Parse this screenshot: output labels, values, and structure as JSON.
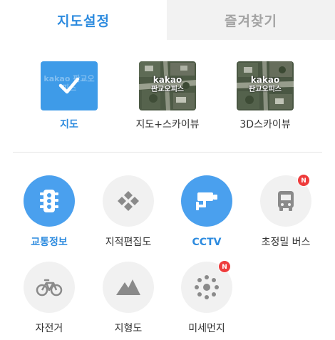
{
  "tabs": [
    {
      "label": "지도설정",
      "active": true
    },
    {
      "label": "즐겨찾기",
      "active": false
    }
  ],
  "map_types": [
    {
      "label": "지도",
      "selected": true,
      "thumb_text": "kakao 판교오피스",
      "icon": "check-icon"
    },
    {
      "label": "지도+스카이뷰",
      "selected": false,
      "thumb_line1": "kakao",
      "thumb_line2": "판교오피스"
    },
    {
      "label": "3D스카이뷰",
      "selected": false,
      "thumb_line1": "kakao",
      "thumb_line2": "판교오피스"
    }
  ],
  "layers": [
    {
      "label": "교통정보",
      "active": true,
      "icon": "traffic-light-icon"
    },
    {
      "label": "지적편집도",
      "active": false,
      "icon": "cadastral-diamonds-icon"
    },
    {
      "label": "CCTV",
      "active": true,
      "icon": "cctv-camera-icon"
    },
    {
      "label": "초정밀 버스",
      "active": false,
      "icon": "bus-icon",
      "badge": "N"
    },
    {
      "label": "자전거",
      "active": false,
      "icon": "bicycle-icon"
    },
    {
      "label": "지형도",
      "active": false,
      "icon": "mountain-icon"
    },
    {
      "label": "미세먼지",
      "active": false,
      "icon": "dust-dots-icon",
      "badge": "N"
    }
  ],
  "colors": {
    "accent": "#2d8bdf",
    "active_circle": "#4aa0ee",
    "inactive_circle": "#f1f1f1",
    "badge": "#ee3b3b"
  }
}
